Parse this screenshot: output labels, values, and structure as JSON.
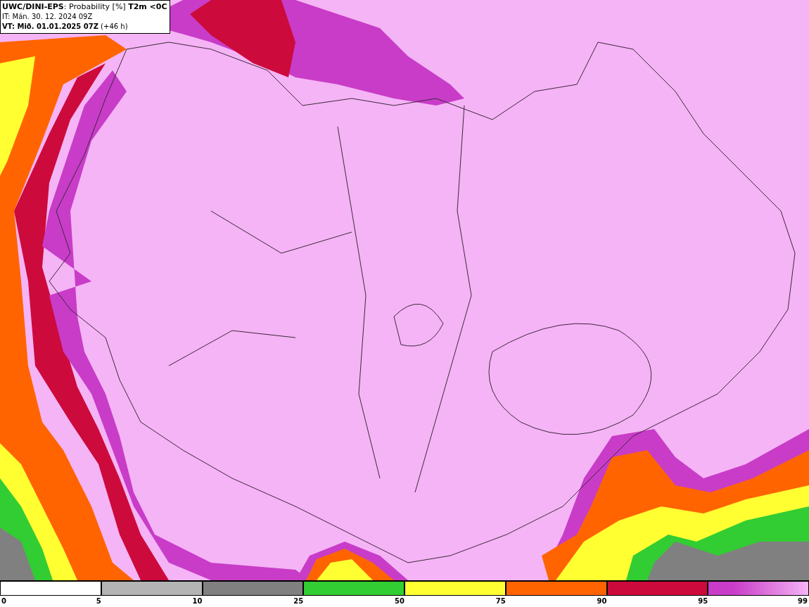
{
  "header": {
    "title": "**UWC/DINI-EPS**: Probability [%] **T2m <0C**",
    "init_time": "IT: Mán. 30. 12. 2024 09Z",
    "valid_time": "**VT: Mið. 01.01.2025 07Z** (+46 h)"
  },
  "legend": {
    "segments": [
      {
        "color": "#ffffff"
      },
      {
        "color": "#b4b4b4"
      },
      {
        "color": "#808080"
      },
      {
        "color": "#32cd32"
      },
      {
        "color": "#ffff32"
      },
      {
        "color": "#ff6400"
      },
      {
        "color": "#cd0a3c"
      },
      {
        "color": "#c83cc8"
      }
    ],
    "labels": [
      "0",
      "5",
      "10",
      "25",
      "50",
      "75",
      "90",
      "95",
      "99"
    ]
  }
}
